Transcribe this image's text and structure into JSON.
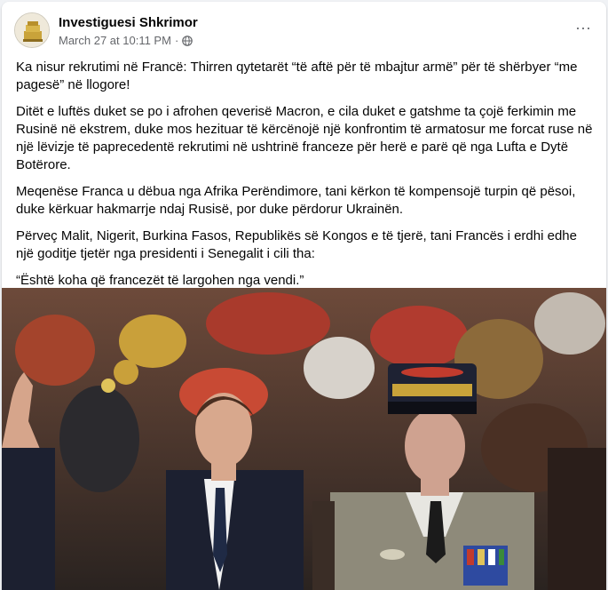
{
  "post": {
    "author": "Investiguesi Shkrimor",
    "timestamp": "March 27 at 10:11 PM",
    "separator": "·",
    "audience_icon": "globe-icon",
    "more_icon": "more-options-icon",
    "more_label": "···",
    "paragraphs": [
      "Ka nisur rekrutimi në Francë: Thirren qytetarët “të aftë për të mbajtur armë” për të shërbyer “me pagesë” në llogore!",
      "Ditët e luftës duket se po i afrohen qeverisë Macron, e cila duket e gatshme ta çojë ferkimin me Rusinë në ekstrem, duke mos hezituar të kërcënojë një konfrontim të armatosur me forcat ruse në një lëvizje të paprecedentë rekrutimi në ushtrinë franceze për herë e parë që nga Lufta e Dytë Botërore.",
      "Meqenëse Franca u dëbua nga Afrika Perëndimore, tani kërkon të kompensojë turpin që pësoi, duke kërkuar hakmarrje ndaj Rusisë, por duke përdorur Ukrainën.",
      "Përveç Malit, Nigerit, Burkina Fasos, Republikës së Kongos e të tjerë, tani Francës i erdhi edhe një goditje tjetër nga presidenti i Senegalit i cili tha:",
      "“Është koha që francezët të largohen nga vendi.”"
    ]
  },
  "colors": {
    "text": "#050505",
    "secondary_text": "#65676b",
    "card": "#ffffff",
    "page": "#f0f2f5"
  }
}
